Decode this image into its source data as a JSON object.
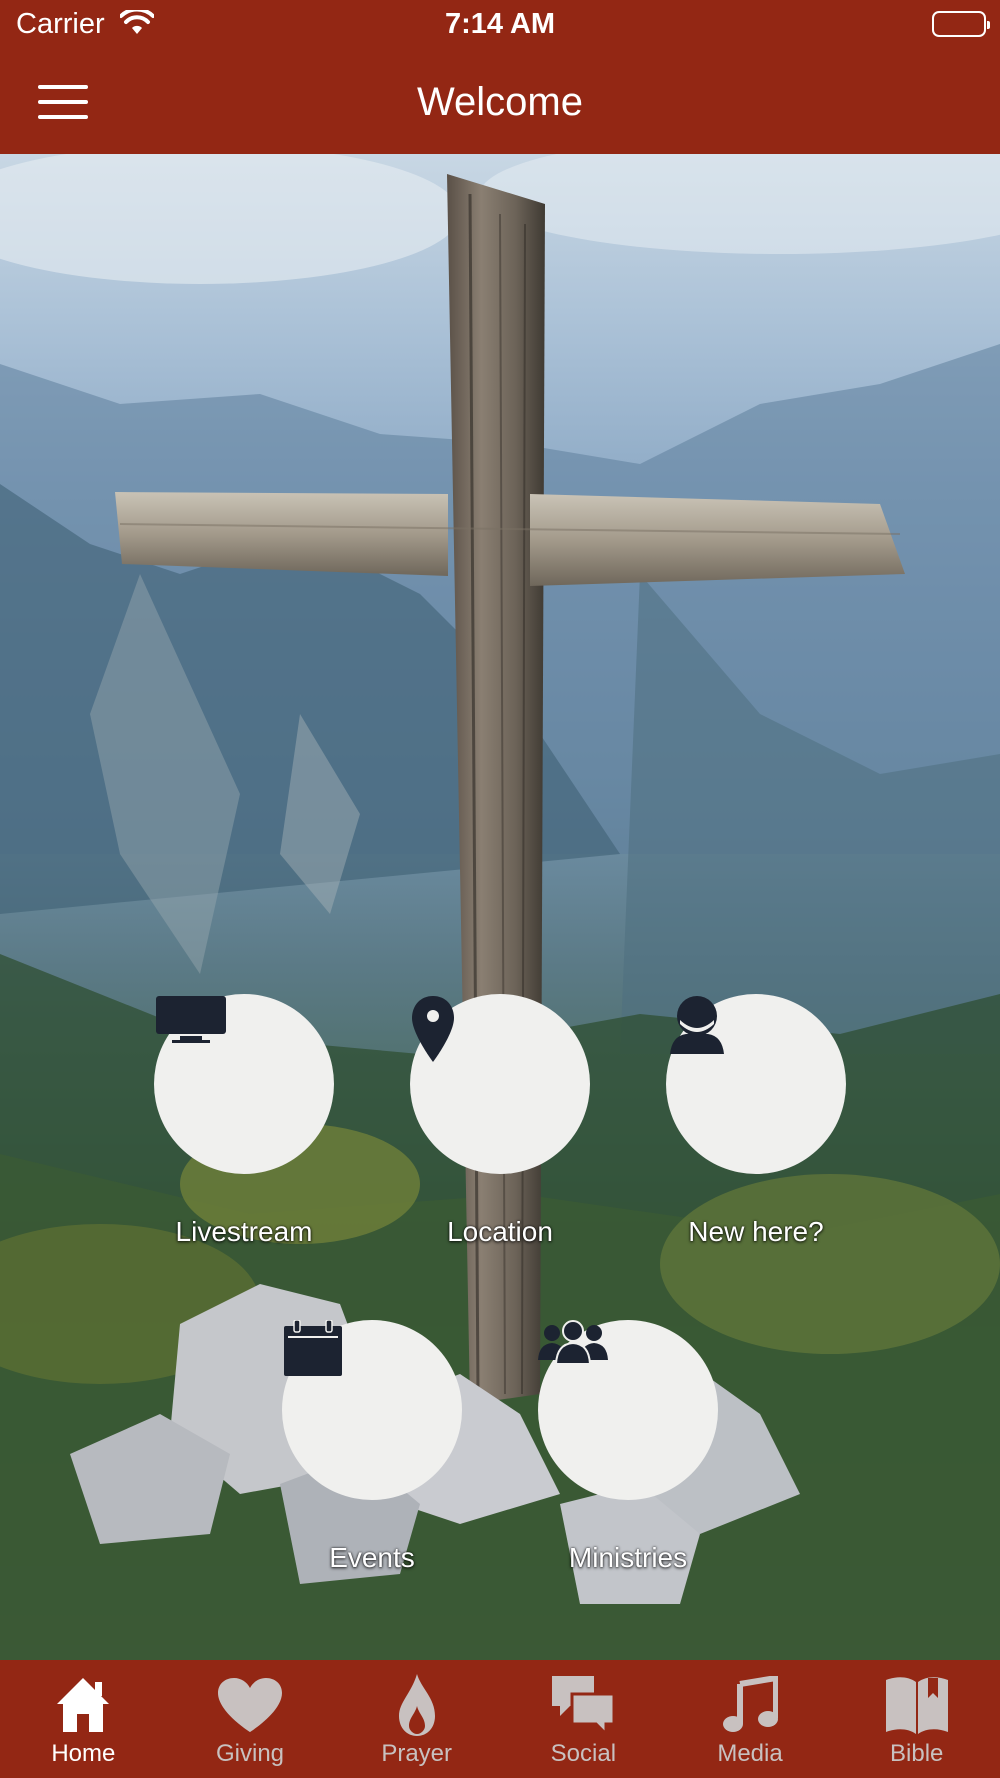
{
  "status_bar": {
    "carrier": "Carrier",
    "time": "7:14 AM"
  },
  "header": {
    "title": "Welcome",
    "menu_icon": "hamburger-menu-icon"
  },
  "quick_links": [
    {
      "label": "Livestream",
      "icon": "tv-icon"
    },
    {
      "label": "Location",
      "icon": "map-pin-icon"
    },
    {
      "label": "New here?",
      "icon": "person-icon"
    },
    {
      "label": "Events",
      "icon": "calendar-icon"
    },
    {
      "label": "Ministries",
      "icon": "group-icon"
    }
  ],
  "tabs": [
    {
      "label": "Home",
      "icon": "home-icon",
      "active": true
    },
    {
      "label": "Giving",
      "icon": "heart-icon",
      "active": false
    },
    {
      "label": "Prayer",
      "icon": "flame-icon",
      "active": false
    },
    {
      "label": "Social",
      "icon": "chat-bubbles-icon",
      "active": false
    },
    {
      "label": "Media",
      "icon": "music-note-icon",
      "active": false
    },
    {
      "label": "Bible",
      "icon": "book-icon",
      "active": false
    }
  ],
  "colors": {
    "brand": "#932714",
    "button_bg": "#f0f0ee",
    "icon": "#1c2331",
    "tab_active": "#ffffff",
    "tab_inactive": "#c8c1c0"
  }
}
